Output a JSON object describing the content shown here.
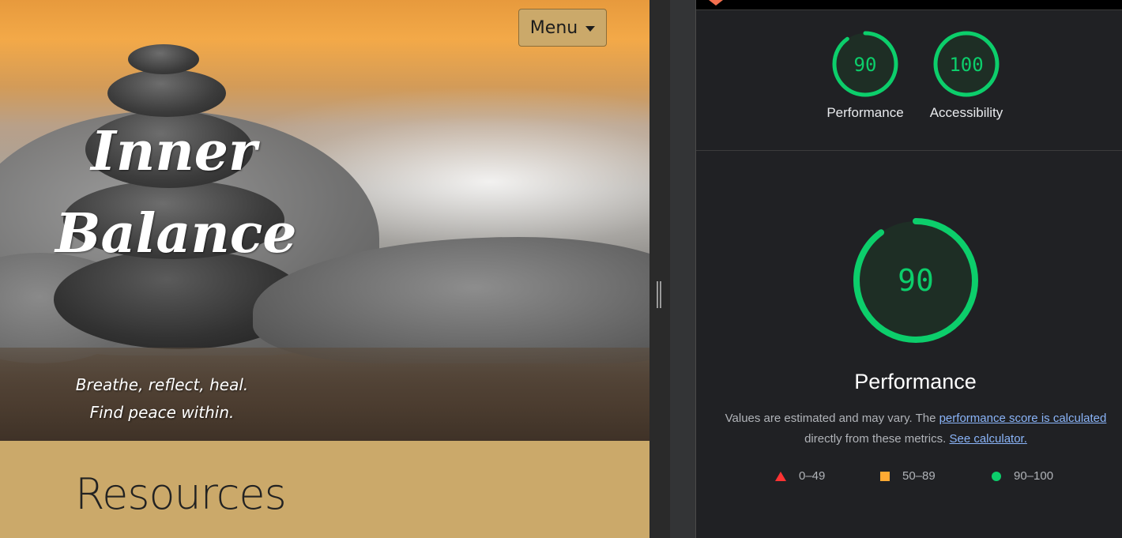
{
  "site": {
    "menu_label": "Menu",
    "title_line1": "Inner",
    "title_line2": "Balance",
    "tagline_line1": "Breathe, reflect, heal.",
    "tagline_line2": "Find peace within.",
    "section_heading": "Resources"
  },
  "lighthouse": {
    "scores": [
      {
        "label": "Performance",
        "value": "90",
        "score": 0.9
      },
      {
        "label": "Accessibility",
        "value": "100",
        "score": 1.0
      }
    ],
    "main": {
      "value": "90",
      "score": 0.9,
      "title": "Performance",
      "desc_prefix": "Values are estimated and may vary. The ",
      "desc_link1": "performance score is calculated",
      "desc_middle": " directly from these metrics. ",
      "desc_link2": "See calculator."
    },
    "legend": [
      {
        "range": "0–49",
        "shape": "triangle",
        "color": "#ff3333"
      },
      {
        "range": "50–89",
        "shape": "square",
        "color": "#ffaa33"
      },
      {
        "range": "90–100",
        "shape": "circle",
        "color": "#0cce6b"
      }
    ],
    "colors": {
      "pass": "#0cce6b",
      "gauge_fill": "#1e2e25",
      "link": "#8ab4f8"
    }
  }
}
